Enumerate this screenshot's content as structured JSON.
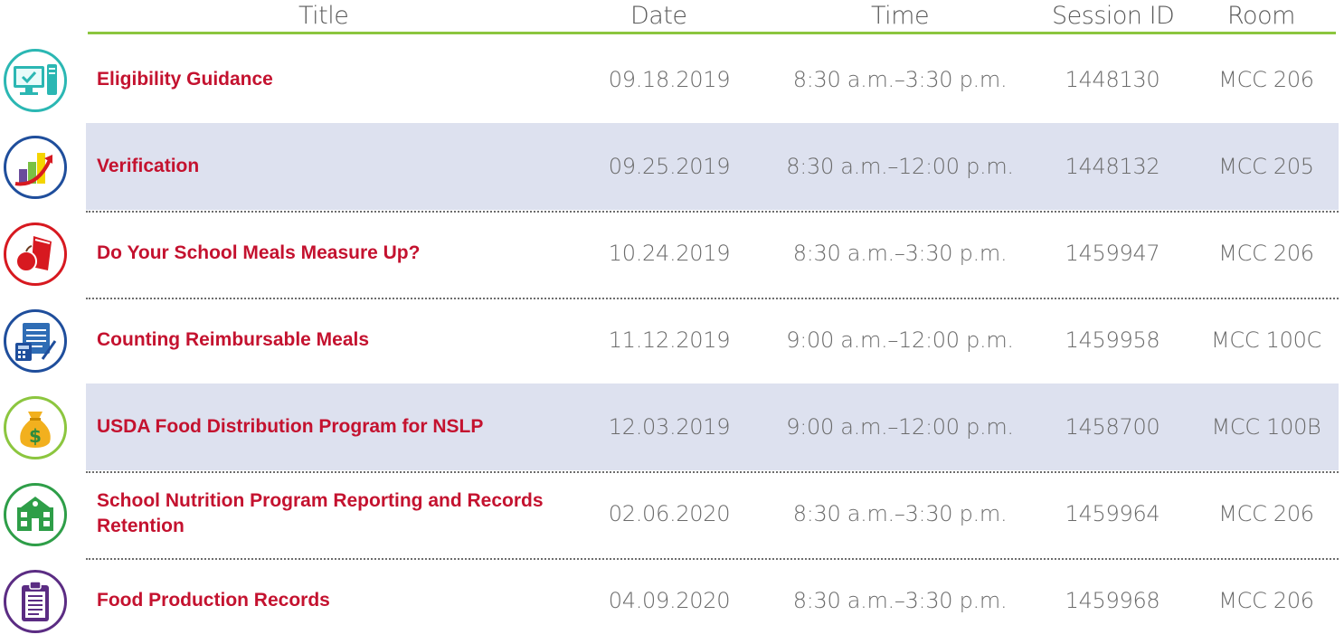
{
  "header": {
    "title": "Title",
    "date": "Date",
    "time": "Time",
    "session_id": "Session ID",
    "room": "Room"
  },
  "colors": {
    "accent_green": "#8cc63f",
    "title_red": "#c4122f",
    "row_shade": "#dde1ef",
    "text_gray": "#6b6b6b"
  },
  "rows": [
    {
      "icon": "computer-icon",
      "title": "Eligibility Guidance",
      "date": "09.18.2019",
      "time": "8:30 a.m.–3:30 p.m.",
      "session_id": "1448130",
      "room": "MCC 206",
      "shaded": false
    },
    {
      "icon": "bar-chart-arrow-icon",
      "title": "Verification",
      "date": "09.25.2019",
      "time": "8:30 a.m.–12:00 p.m.",
      "session_id": "1448132",
      "room": "MCC 205",
      "shaded": true
    },
    {
      "icon": "apple-lunch-bag-icon",
      "title": "Do Your School Meals Measure Up?",
      "date": "10.24.2019",
      "time": "8:30 a.m.–3:30 p.m.",
      "session_id": "1459947",
      "room": "MCC 206",
      "shaded": false
    },
    {
      "icon": "calculator-notepad-icon",
      "title": "Counting Reimbursable Meals",
      "date": "11.12.2019",
      "time": "9:00 a.m.–12:00 p.m.",
      "session_id": "1459958",
      "room": "MCC 100C",
      "shaded": false
    },
    {
      "icon": "money-bag-icon",
      "title": "USDA Food Distribution Program for NSLP",
      "date": "12.03.2019",
      "time": "9:00 a.m.–12:00 p.m.",
      "session_id": "1458700",
      "room": "MCC 100B",
      "shaded": true
    },
    {
      "icon": "school-building-icon",
      "title": "School Nutrition Program Reporting and Records Retention",
      "date": "02.06.2020",
      "time": "8:30 a.m.–3:30 p.m.",
      "session_id": "1459964",
      "room": "MCC 206",
      "shaded": false
    },
    {
      "icon": "clipboard-icon",
      "title": "Food Production Records",
      "date": "04.09.2020",
      "time": "8:30 a.m.–3:30 p.m.",
      "session_id": "1459968",
      "room": "MCC 206",
      "shaded": false
    }
  ]
}
